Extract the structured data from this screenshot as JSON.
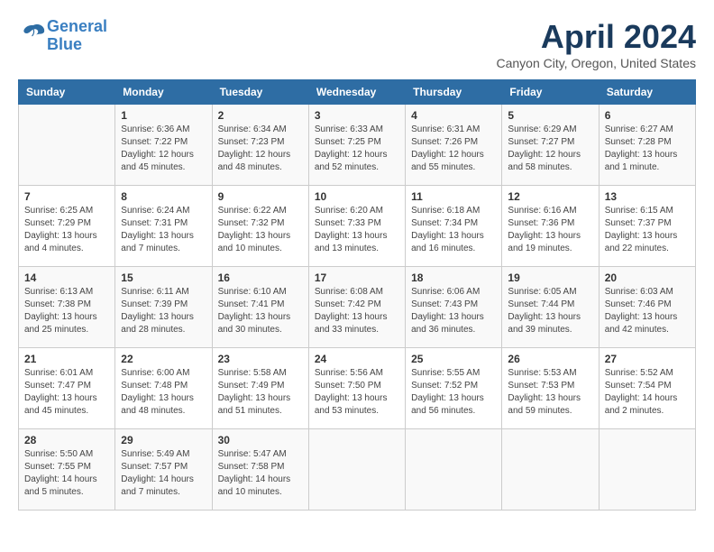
{
  "header": {
    "logo_line1": "General",
    "logo_line2": "Blue",
    "month": "April 2024",
    "location": "Canyon City, Oregon, United States"
  },
  "weekdays": [
    "Sunday",
    "Monday",
    "Tuesday",
    "Wednesday",
    "Thursday",
    "Friday",
    "Saturday"
  ],
  "weeks": [
    [
      {
        "day": null,
        "sunrise": null,
        "sunset": null,
        "daylight": null
      },
      {
        "day": "1",
        "sunrise": "6:36 AM",
        "sunset": "7:22 PM",
        "daylight": "12 hours and 45 minutes."
      },
      {
        "day": "2",
        "sunrise": "6:34 AM",
        "sunset": "7:23 PM",
        "daylight": "12 hours and 48 minutes."
      },
      {
        "day": "3",
        "sunrise": "6:33 AM",
        "sunset": "7:25 PM",
        "daylight": "12 hours and 52 minutes."
      },
      {
        "day": "4",
        "sunrise": "6:31 AM",
        "sunset": "7:26 PM",
        "daylight": "12 hours and 55 minutes."
      },
      {
        "day": "5",
        "sunrise": "6:29 AM",
        "sunset": "7:27 PM",
        "daylight": "12 hours and 58 minutes."
      },
      {
        "day": "6",
        "sunrise": "6:27 AM",
        "sunset": "7:28 PM",
        "daylight": "13 hours and 1 minute."
      }
    ],
    [
      {
        "day": "7",
        "sunrise": "6:25 AM",
        "sunset": "7:29 PM",
        "daylight": "13 hours and 4 minutes."
      },
      {
        "day": "8",
        "sunrise": "6:24 AM",
        "sunset": "7:31 PM",
        "daylight": "13 hours and 7 minutes."
      },
      {
        "day": "9",
        "sunrise": "6:22 AM",
        "sunset": "7:32 PM",
        "daylight": "13 hours and 10 minutes."
      },
      {
        "day": "10",
        "sunrise": "6:20 AM",
        "sunset": "7:33 PM",
        "daylight": "13 hours and 13 minutes."
      },
      {
        "day": "11",
        "sunrise": "6:18 AM",
        "sunset": "7:34 PM",
        "daylight": "13 hours and 16 minutes."
      },
      {
        "day": "12",
        "sunrise": "6:16 AM",
        "sunset": "7:36 PM",
        "daylight": "13 hours and 19 minutes."
      },
      {
        "day": "13",
        "sunrise": "6:15 AM",
        "sunset": "7:37 PM",
        "daylight": "13 hours and 22 minutes."
      }
    ],
    [
      {
        "day": "14",
        "sunrise": "6:13 AM",
        "sunset": "7:38 PM",
        "daylight": "13 hours and 25 minutes."
      },
      {
        "day": "15",
        "sunrise": "6:11 AM",
        "sunset": "7:39 PM",
        "daylight": "13 hours and 28 minutes."
      },
      {
        "day": "16",
        "sunrise": "6:10 AM",
        "sunset": "7:41 PM",
        "daylight": "13 hours and 30 minutes."
      },
      {
        "day": "17",
        "sunrise": "6:08 AM",
        "sunset": "7:42 PM",
        "daylight": "13 hours and 33 minutes."
      },
      {
        "day": "18",
        "sunrise": "6:06 AM",
        "sunset": "7:43 PM",
        "daylight": "13 hours and 36 minutes."
      },
      {
        "day": "19",
        "sunrise": "6:05 AM",
        "sunset": "7:44 PM",
        "daylight": "13 hours and 39 minutes."
      },
      {
        "day": "20",
        "sunrise": "6:03 AM",
        "sunset": "7:46 PM",
        "daylight": "13 hours and 42 minutes."
      }
    ],
    [
      {
        "day": "21",
        "sunrise": "6:01 AM",
        "sunset": "7:47 PM",
        "daylight": "13 hours and 45 minutes."
      },
      {
        "day": "22",
        "sunrise": "6:00 AM",
        "sunset": "7:48 PM",
        "daylight": "13 hours and 48 minutes."
      },
      {
        "day": "23",
        "sunrise": "5:58 AM",
        "sunset": "7:49 PM",
        "daylight": "13 hours and 51 minutes."
      },
      {
        "day": "24",
        "sunrise": "5:56 AM",
        "sunset": "7:50 PM",
        "daylight": "13 hours and 53 minutes."
      },
      {
        "day": "25",
        "sunrise": "5:55 AM",
        "sunset": "7:52 PM",
        "daylight": "13 hours and 56 minutes."
      },
      {
        "day": "26",
        "sunrise": "5:53 AM",
        "sunset": "7:53 PM",
        "daylight": "13 hours and 59 minutes."
      },
      {
        "day": "27",
        "sunrise": "5:52 AM",
        "sunset": "7:54 PM",
        "daylight": "14 hours and 2 minutes."
      }
    ],
    [
      {
        "day": "28",
        "sunrise": "5:50 AM",
        "sunset": "7:55 PM",
        "daylight": "14 hours and 5 minutes."
      },
      {
        "day": "29",
        "sunrise": "5:49 AM",
        "sunset": "7:57 PM",
        "daylight": "14 hours and 7 minutes."
      },
      {
        "day": "30",
        "sunrise": "5:47 AM",
        "sunset": "7:58 PM",
        "daylight": "14 hours and 10 minutes."
      },
      null,
      null,
      null,
      null
    ]
  ],
  "labels": {
    "sunrise": "Sunrise:",
    "sunset": "Sunset:",
    "daylight": "Daylight:"
  }
}
